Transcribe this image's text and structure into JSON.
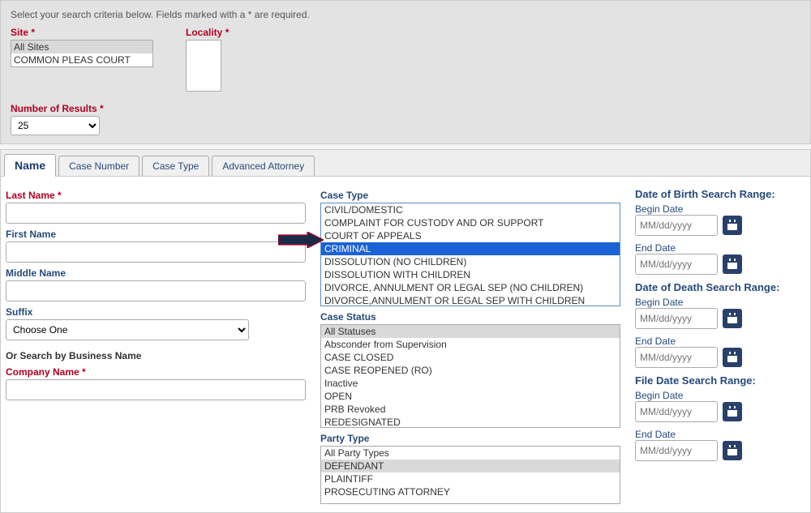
{
  "intro": "Select your search criteria below. Fields marked with a * are required.",
  "site": {
    "label": "Site",
    "options": [
      "All Sites",
      "COMMON PLEAS COURT"
    ],
    "selected": 0
  },
  "locality": {
    "label": "Locality"
  },
  "numResults": {
    "label": "Number of Results",
    "value": "25"
  },
  "tabs": [
    "Name",
    "Case Number",
    "Case Type",
    "Advanced Attorney"
  ],
  "col1": {
    "lastName": "Last Name",
    "firstName": "First Name",
    "middleName": "Middle Name",
    "suffix": "Suffix",
    "suffixPlaceholder": "Choose One",
    "orSearch": "Or Search by Business Name",
    "companyName": "Company Name"
  },
  "col2": {
    "caseType": {
      "label": "Case Type",
      "options": [
        "CIVIL/DOMESTIC",
        "COMPLAINT FOR CUSTODY AND OR SUPPORT",
        "COURT OF APPEALS",
        "CRIMINAL",
        "DISSOLUTION (NO CHILDREN)",
        "DISSOLUTION WITH CHILDREN",
        "DIVORCE, ANNULMENT OR LEGAL SEP (NO CHILDREN)",
        "DIVORCE,ANNULMENT OR LEGAL SEP WITH CHILDREN"
      ],
      "highlight": 3
    },
    "caseStatus": {
      "label": "Case Status",
      "options": [
        "All Statuses",
        "Absconder from Supervision",
        "CASE CLOSED",
        "CASE REOPENED (RO)",
        "Inactive",
        "OPEN",
        "PRB Revoked",
        "REDESIGNATED"
      ],
      "selected": 0
    },
    "partyType": {
      "label": "Party Type",
      "options": [
        "All Party Types",
        "DEFENDANT",
        "PLAINTIFF",
        "PROSECUTING ATTORNEY"
      ],
      "selected": 1
    }
  },
  "col3": {
    "dobTitle": "Date of Birth Search Range:",
    "dodTitle": "Date of Death Search Range:",
    "fileTitle": "File Date Search Range:",
    "begin": "Begin Date",
    "end": "End Date",
    "placeholder": "MM/dd/yyyy"
  }
}
